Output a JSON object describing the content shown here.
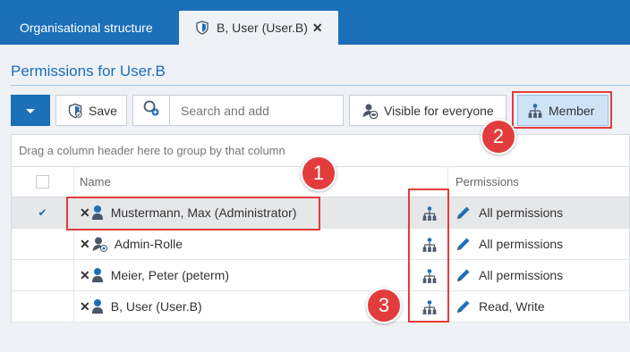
{
  "tabs": [
    {
      "label": "Organisational structure",
      "active": false
    },
    {
      "label": "B, User (User.B)",
      "active": true,
      "close": "✕"
    }
  ],
  "page_title": "Permissions for User.B",
  "toolbar": {
    "save_label": "Save",
    "search_placeholder": "Search and add",
    "visible_label": "Visible for everyone",
    "member_label": "Member"
  },
  "grid": {
    "group_hint": "Drag a column header here to group by that column",
    "columns": {
      "name": "Name",
      "permissions": "Permissions"
    },
    "rows": [
      {
        "name": "Mustermann, Max (Administrator)",
        "permissions": "All permissions",
        "selected": true,
        "type": "user"
      },
      {
        "name": "Admin-Rolle",
        "permissions": "All permissions",
        "selected": false,
        "type": "role"
      },
      {
        "name": "Meier, Peter (peterm)",
        "permissions": "All permissions",
        "selected": false,
        "type": "user"
      },
      {
        "name": "B, User (User.B)",
        "permissions": "Read, Write",
        "selected": false,
        "type": "user"
      }
    ]
  },
  "annotations": [
    "1",
    "2",
    "3"
  ],
  "colors": {
    "accent": "#1c6fb9",
    "highlight": "#e23c3c",
    "member_bg": "#cfe3f7"
  },
  "icons": [
    "shield-icon",
    "chevron-down-icon",
    "search-add-icon",
    "visible-icon",
    "member-icon",
    "user-icon",
    "role-icon",
    "remove-icon",
    "pencil-icon"
  ]
}
